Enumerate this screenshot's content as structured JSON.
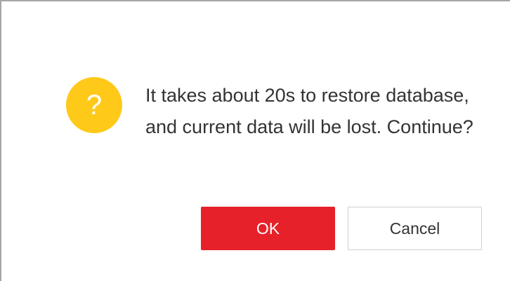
{
  "dialog": {
    "icon": "question-icon",
    "icon_glyph": "?",
    "icon_color": "#ffc91a",
    "message": "It takes about 20s to restore database, and current data will be lost. Continue?",
    "ok_label": "OK",
    "cancel_label": "Cancel",
    "ok_color": "#e6212a"
  }
}
